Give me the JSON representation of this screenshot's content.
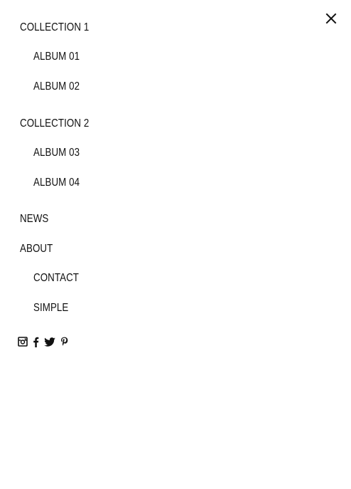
{
  "close": {
    "icon": "close-icon"
  },
  "menu": {
    "collection_1": "COLLECTION 1",
    "album_01": "ALBUM 01",
    "album_02": "ALBUM 02",
    "collection_2": "COLLECTION 2",
    "album_03": "ALBUM 03",
    "album_04": "ALBUM 04",
    "news": "NEWS",
    "about": "ABOUT",
    "contact": "CONTACT",
    "simple": "SIMPLE"
  },
  "social": {
    "icons": [
      "instagram-icon",
      "facebook-icon",
      "twitter-icon",
      "pinterest-icon"
    ]
  },
  "colors": {
    "text": "#111111",
    "background": "#ffffff"
  }
}
